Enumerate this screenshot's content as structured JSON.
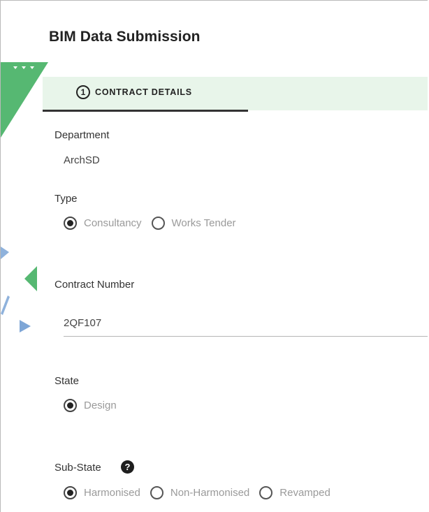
{
  "header": {
    "title": "BIM Data Submission"
  },
  "stepper": {
    "step_number": "1",
    "step_label": "CONTRACT DETAILS"
  },
  "form": {
    "department": {
      "label": "Department",
      "value": "ArchSD"
    },
    "type": {
      "label": "Type",
      "options": [
        {
          "label": "Consultancy",
          "selected": true
        },
        {
          "label": "Works Tender",
          "selected": false
        }
      ]
    },
    "contract_number": {
      "label": "Contract Number",
      "value": "2QF107"
    },
    "state": {
      "label": "State",
      "options": [
        {
          "label": "Design",
          "selected": true
        }
      ]
    },
    "sub_state": {
      "label": "Sub-State",
      "help_icon": "question-icon",
      "help_glyph": "?",
      "options": [
        {
          "label": "Harmonised",
          "selected": true
        },
        {
          "label": "Non-Harmonised",
          "selected": false
        },
        {
          "label": "Revamped",
          "selected": false
        }
      ]
    }
  },
  "colors": {
    "step_bar_bg": "#e8f5ea",
    "accent_green": "#4caf6a",
    "accent_blue": "#7ea6d6",
    "text_dark": "#222222",
    "option_text": "#9a9a9a"
  }
}
